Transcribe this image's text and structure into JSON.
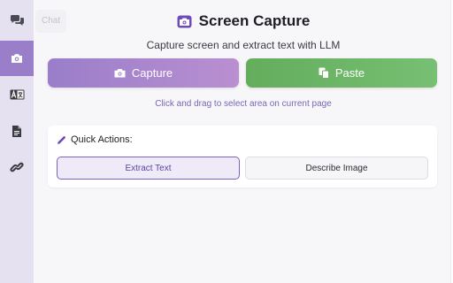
{
  "sidebar": {
    "items": [
      {
        "icon": "chat-icon",
        "label": "Chat"
      },
      {
        "icon": "camera-icon",
        "active": true
      },
      {
        "icon": "translate-icon"
      },
      {
        "icon": "document-icon"
      },
      {
        "icon": "link-icon"
      }
    ],
    "tooltip": "Chat"
  },
  "header": {
    "title": "Screen Capture",
    "subtitle": "Capture screen and extract text with LLM"
  },
  "actions": {
    "capture_label": "Capture",
    "paste_label": "Paste"
  },
  "hint": "Click and drag to select area on current page",
  "quick_actions": {
    "title": "Quick Actions:",
    "extract_label": "Extract Text",
    "describe_label": "Describe Image"
  },
  "colors": {
    "accent": "#9a7ec9",
    "paste_green": "#63ad5d",
    "sidebar_bg": "#e6e1f1",
    "hint_purple": "#7b66b3"
  }
}
